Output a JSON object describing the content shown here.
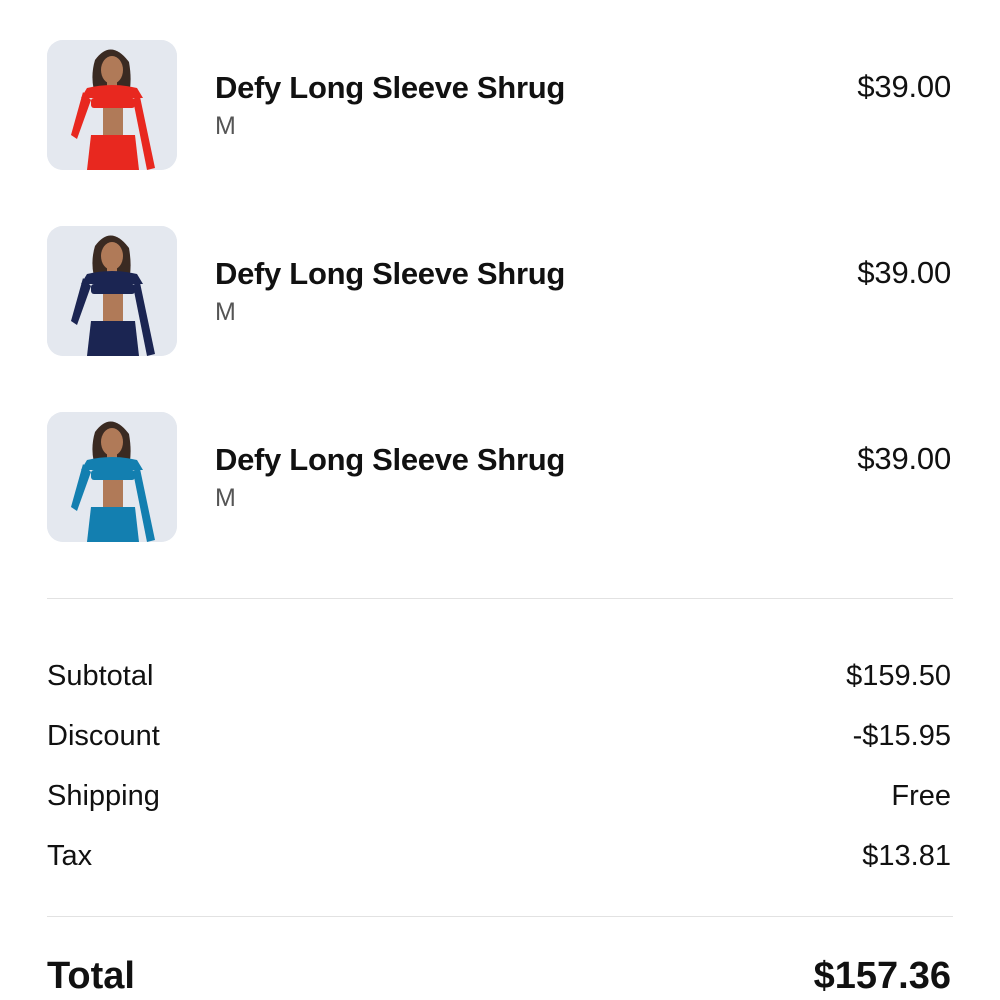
{
  "order_items": [
    {
      "name": "Defy Long Sleeve Shrug",
      "variant": "M",
      "price": "$39.00",
      "image": "product-photo-red-shrug",
      "garment_color": "#e8281f"
    },
    {
      "name": "Defy Long Sleeve Shrug",
      "variant": "M",
      "price": "$39.00",
      "image": "product-photo-navy-shrug",
      "garment_color": "#1b2552"
    },
    {
      "name": "Defy Long Sleeve Shrug",
      "variant": "M",
      "price": "$39.00",
      "image": "product-photo-teal-shrug",
      "garment_color": "#137fb0"
    }
  ],
  "summary": {
    "subtotal_label": "Subtotal",
    "subtotal_value": "$159.50",
    "discount_label": "Discount",
    "discount_value": "-$15.95",
    "shipping_label": "Shipping",
    "shipping_value": "Free",
    "tax_label": "Tax",
    "tax_value": "$13.81"
  },
  "total": {
    "label": "Total",
    "value": "$157.36"
  },
  "colors": {
    "text": "#111111",
    "secondary_text": "#555555",
    "divider": "#e2e2e2",
    "thumb_background": "#e4e8ef"
  }
}
